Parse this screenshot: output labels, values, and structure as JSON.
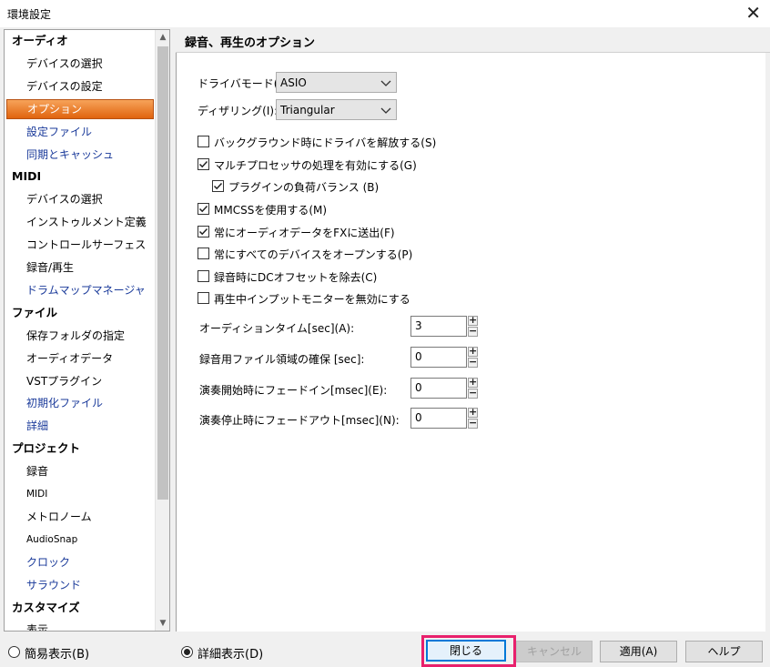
{
  "window": {
    "title": "環境設定",
    "close_glyph": "✕"
  },
  "sidebar": {
    "groups": [
      {
        "label": "オーディオ",
        "items": [
          {
            "label": "デバイスの選択"
          },
          {
            "label": "デバイスの設定"
          },
          {
            "label": "オプション",
            "selected": true
          },
          {
            "label": "設定ファイル",
            "blue": true
          },
          {
            "label": "同期とキャッシュ",
            "blue": true
          }
        ]
      },
      {
        "label": "MIDI",
        "items": [
          {
            "label": "デバイスの選択"
          },
          {
            "label": "インストゥルメント定義"
          },
          {
            "label": "コントロールサーフェス"
          },
          {
            "label": "録音/再生"
          },
          {
            "label": "ドラムマップマネージャ",
            "blue": true
          }
        ]
      },
      {
        "label": "ファイル",
        "items": [
          {
            "label": "保存フォルダの指定"
          },
          {
            "label": "オーディオデータ"
          },
          {
            "label": "VSTプラグイン"
          },
          {
            "label": "初期化ファイル",
            "blue": true
          },
          {
            "label": "詳細",
            "blue": true
          }
        ]
      },
      {
        "label": "プロジェクト",
        "items": [
          {
            "label": "録音"
          },
          {
            "label": "MIDI",
            "small": true
          },
          {
            "label": "メトロノーム"
          },
          {
            "label": "AudioSnap",
            "small": true
          },
          {
            "label": "クロック",
            "blue": true
          },
          {
            "label": "サラウンド",
            "blue": true
          }
        ]
      },
      {
        "label": "カスタマイズ",
        "items": [
          {
            "label": "表示"
          }
        ]
      }
    ]
  },
  "panel": {
    "title": "録音、再生のオプション",
    "driver_mode": {
      "label": "ドライバモード(D):",
      "value": "ASIO"
    },
    "dithering": {
      "label": "ディザリング(I):",
      "value": "Triangular"
    },
    "checkboxes": [
      {
        "label": "バックグラウンド時にドライバを解放する(S)",
        "checked": false
      },
      {
        "label": "マルチプロセッサの処理を有効にする(G)",
        "checked": true
      },
      {
        "label": "プラグインの負荷バランス (B)",
        "checked": true,
        "indent": true
      },
      {
        "label": "MMCSSを使用する(M)",
        "checked": true
      },
      {
        "label": "常にオーディオデータをFXに送出(F)",
        "checked": true
      },
      {
        "label": "常にすべてのデバイスをオープンする(P)",
        "checked": false
      },
      {
        "label": "録音時にDCオフセットを除去(C)",
        "checked": false
      },
      {
        "label": "再生中インプットモニターを無効にする",
        "checked": false
      }
    ],
    "numeric_fields": [
      {
        "label": "オーディションタイム[sec](A):",
        "value": "3"
      },
      {
        "label": "録音用ファイル領域の確保 [sec]:",
        "value": "0"
      },
      {
        "label": "演奏開始時にフェードイン[msec](E):",
        "value": "0"
      },
      {
        "label": "演奏停止時にフェードアウト[msec](N):",
        "value": "0"
      }
    ]
  },
  "bottom": {
    "simple_view": {
      "label": "簡易表示(B)",
      "selected": false
    },
    "detail_view": {
      "label": "詳細表示(D)",
      "selected": true
    },
    "close_button": "閉じる",
    "cancel_button": "キャンセル",
    "apply_button": "適用(A)",
    "help_button": "ヘルプ"
  },
  "colors": {
    "selection": "#e97a2c",
    "highlight_frame": "#e8206c",
    "link_blue": "#1a3a9a"
  }
}
